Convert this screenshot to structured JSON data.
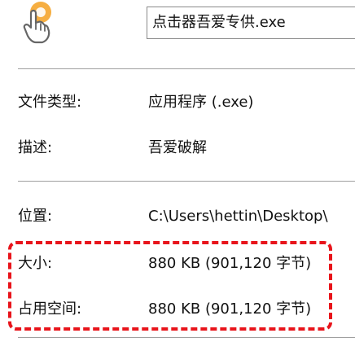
{
  "header": {
    "icon": "hand-pointer-icon",
    "file_name": "点击器吾爱专供.exe"
  },
  "properties": {
    "file_type": {
      "label": "文件类型:",
      "value": "应用程序 (.exe)"
    },
    "description": {
      "label": "描述:",
      "value": "吾爱破解"
    },
    "location": {
      "label": "位置:",
      "value": "C:\\Users\\hettin\\Desktop\\"
    },
    "size": {
      "label": "大小:",
      "value": "880 KB (901,120 字节)"
    },
    "size_on_disk": {
      "label": "占用空间:",
      "value": "880 KB (901,120 字节)"
    }
  },
  "colors": {
    "highlight": "#e8141b",
    "icon_accent": "#f5a020",
    "divider": "#a0a0a0"
  }
}
